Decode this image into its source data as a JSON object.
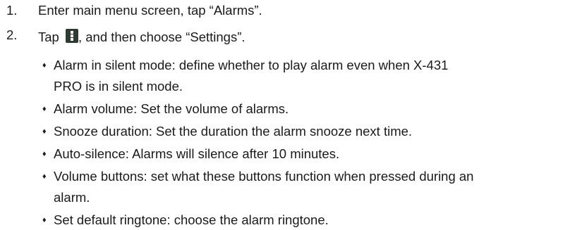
{
  "steps": [
    {
      "number": "1.",
      "text": "Enter main menu screen, tap “Alarms”."
    },
    {
      "number": "2.",
      "text_before": "Tap",
      "text_after": ", and then choose “Settings”.",
      "icon": "overflow-menu-icon"
    }
  ],
  "bullet_marker": "♦",
  "bullets": [
    {
      "lines": [
        "Alarm in silent mode: define whether to play alarm even when X-431",
        "PRO is in silent mode."
      ]
    },
    {
      "lines": [
        "Alarm volume: Set the volume of alarms."
      ]
    },
    {
      "lines": [
        "Snooze duration: Set the duration the alarm snooze next time."
      ]
    },
    {
      "lines": [
        "Auto-silence: Alarms will silence after 10 minutes."
      ]
    },
    {
      "lines": [
        "Volume buttons: set what these buttons function when pressed during an",
        "alarm."
      ]
    },
    {
      "lines": [
        "Set default ringtone: choose the alarm ringtone."
      ]
    }
  ]
}
